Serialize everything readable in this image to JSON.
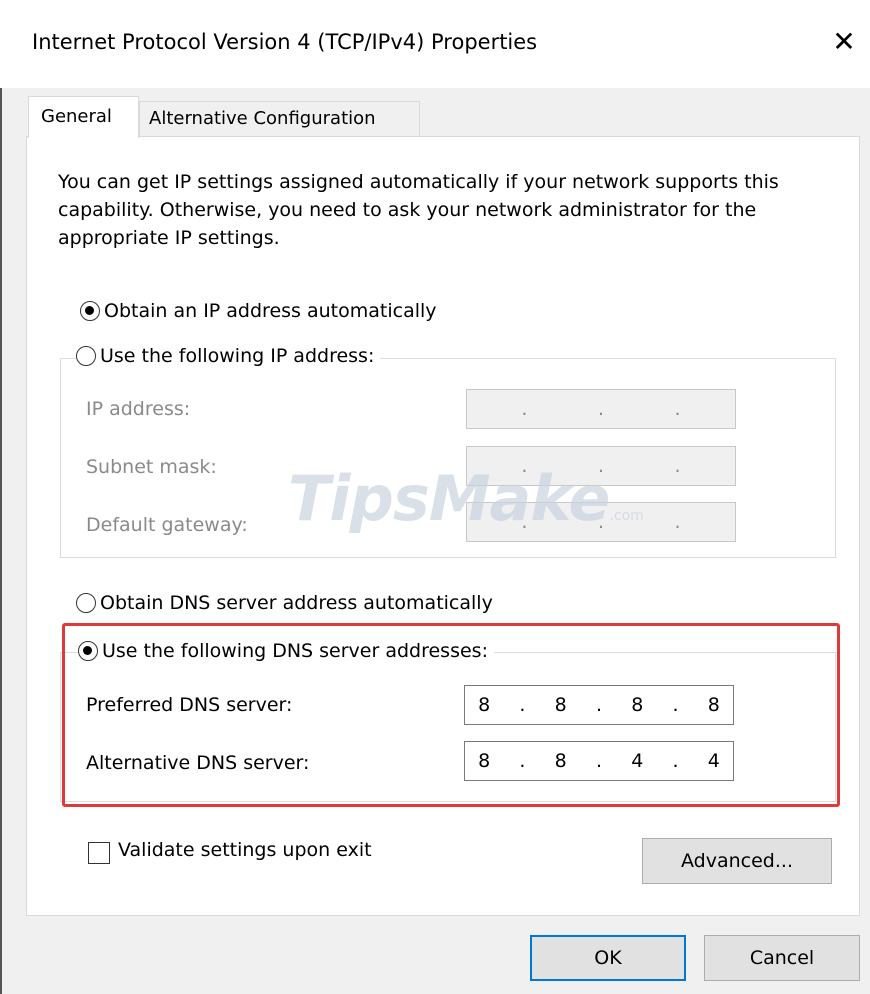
{
  "window": {
    "title": "Internet Protocol Version 4 (TCP/IPv4) Properties",
    "close_glyph": "✕"
  },
  "tabs": [
    {
      "label": "General",
      "selected": true
    },
    {
      "label": "Alternative Configuration",
      "selected": false
    }
  ],
  "description": "You can get IP settings assigned automatically if your network supports this capability. Otherwise, you need to ask your network administrator for the appropriate IP settings.",
  "ip_section": {
    "auto_label": "Obtain an IP address automatically",
    "auto_selected": true,
    "manual_label": "Use the following IP address:",
    "manual_selected": false,
    "fields": [
      {
        "label": "IP address:",
        "octets": [
          "",
          "",
          "",
          ""
        ]
      },
      {
        "label": "Subnet mask:",
        "octets": [
          "",
          "",
          "",
          ""
        ]
      },
      {
        "label": "Default gateway:",
        "octets": [
          "",
          "",
          "",
          ""
        ]
      }
    ]
  },
  "dns_section": {
    "auto_label": "Obtain DNS server address automatically",
    "auto_selected": false,
    "manual_label": "Use the following DNS server addresses:",
    "manual_selected": true,
    "preferred": {
      "label": "Preferred DNS server:",
      "octets": [
        "8",
        "8",
        "8",
        "8"
      ]
    },
    "alternative": {
      "label": "Alternative DNS server:",
      "octets": [
        "8",
        "8",
        "4",
        "4"
      ]
    }
  },
  "validate": {
    "label": "Validate settings upon exit",
    "checked": false
  },
  "buttons": {
    "advanced": "Advanced...",
    "ok": "OK",
    "cancel": "Cancel"
  },
  "watermark": {
    "text": "TipsMake",
    "suffix": ".com"
  },
  "colors": {
    "highlight": "#e0393b",
    "ok_border": "#0078d7",
    "disabled_text": "#8a8a8a"
  }
}
